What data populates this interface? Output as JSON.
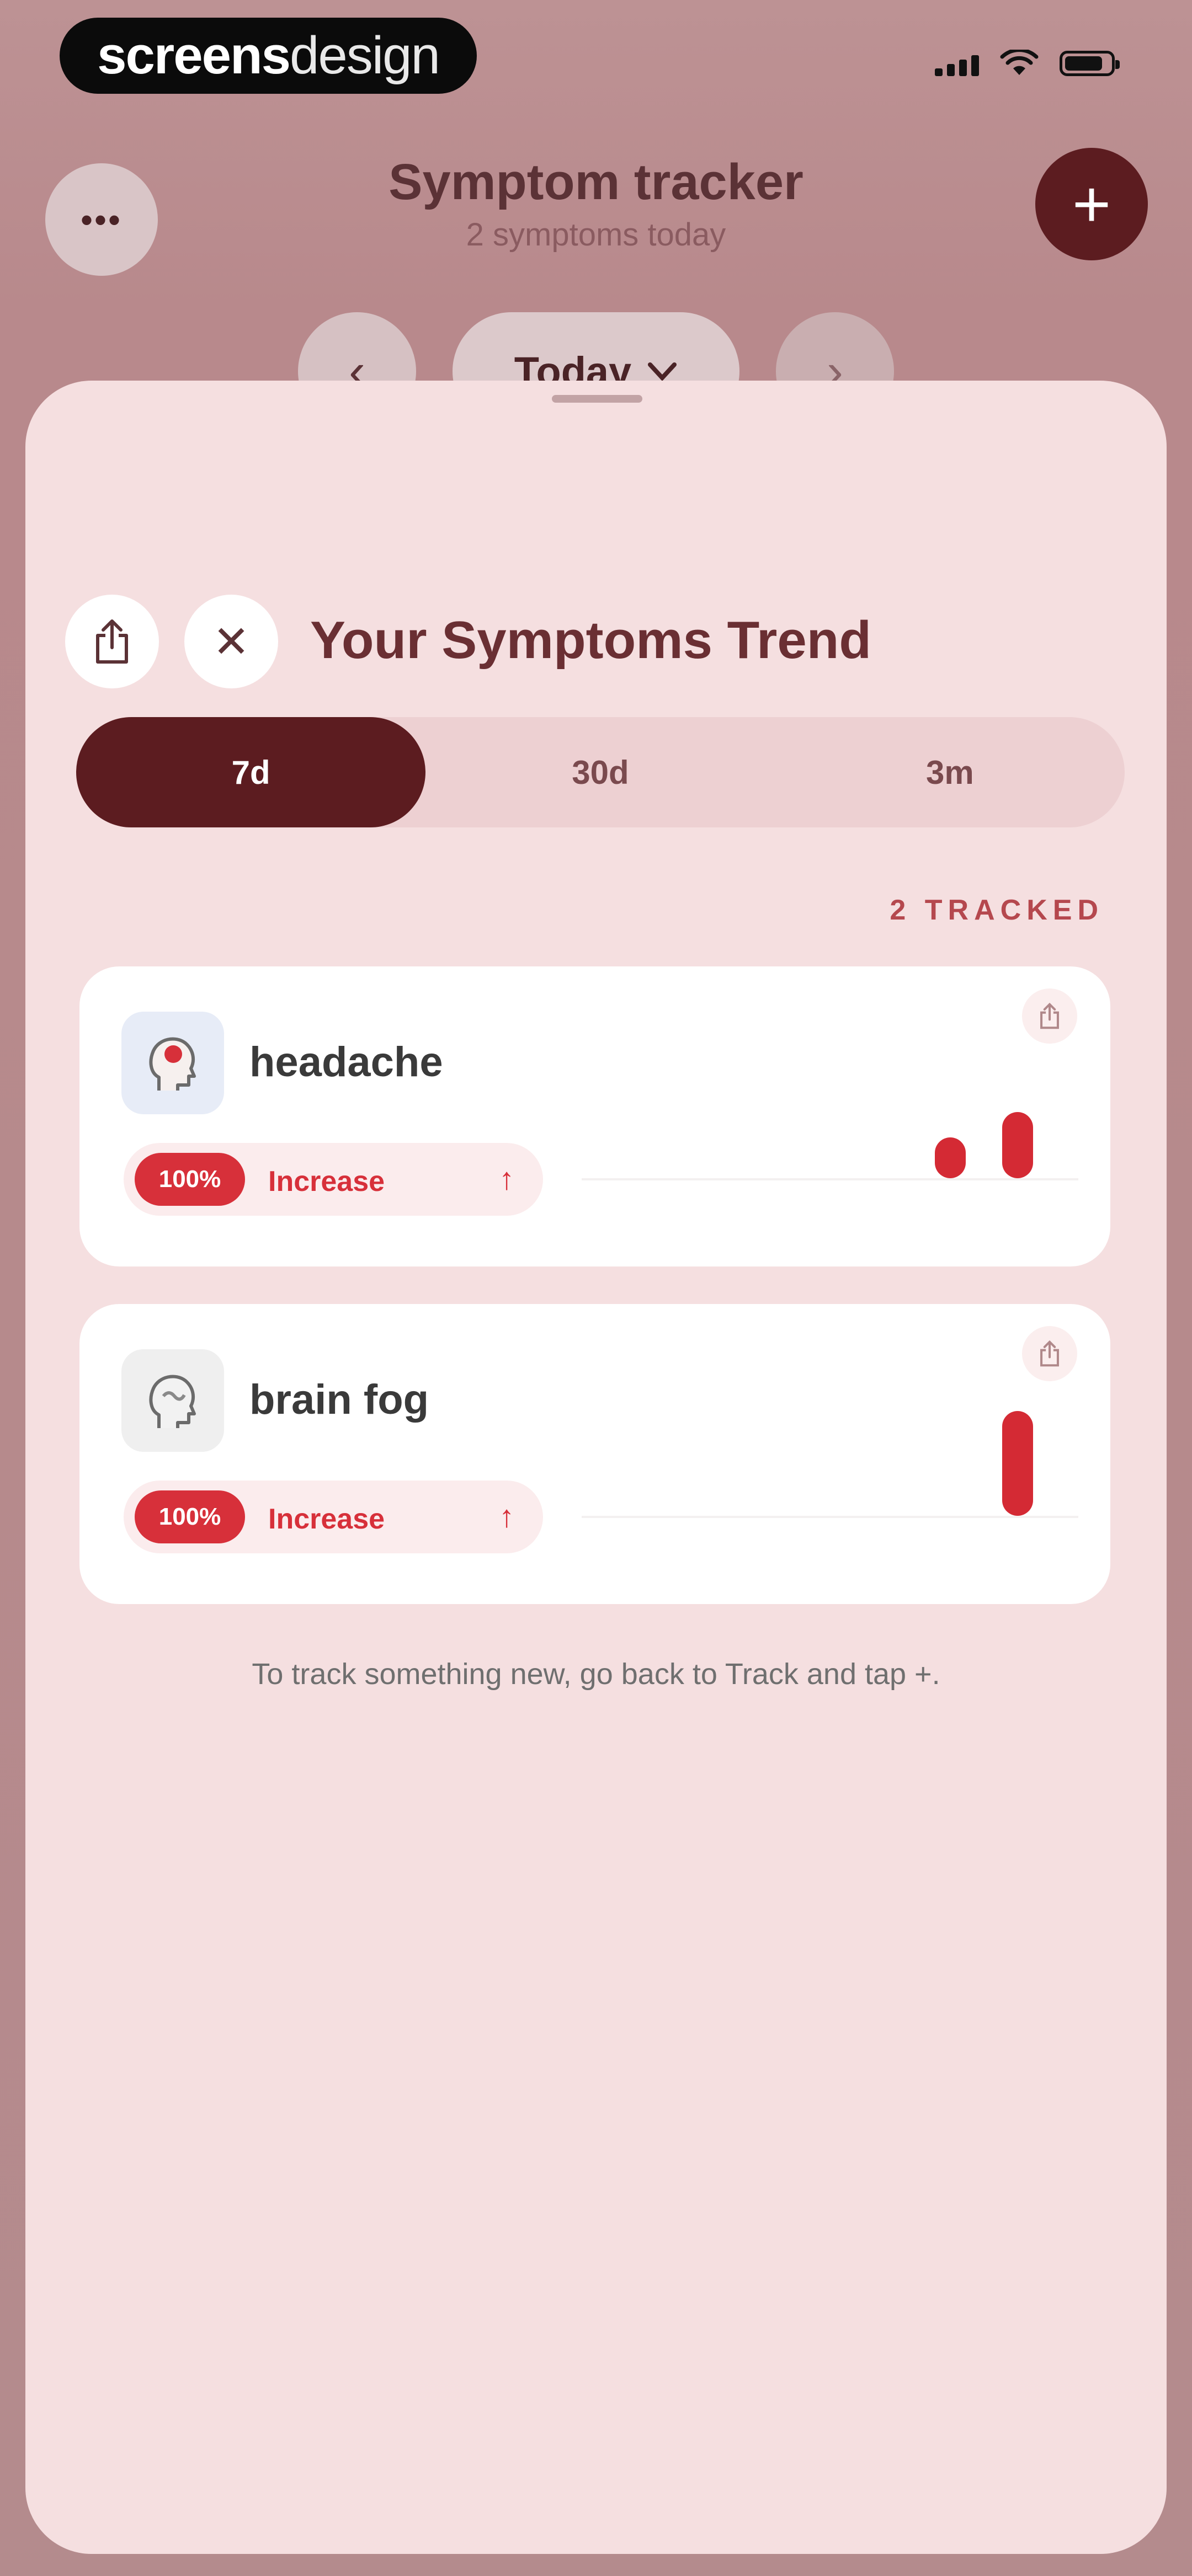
{
  "status_bar": {
    "brand_part1": "screens",
    "brand_part2": "design",
    "icons": [
      "cellular-signal-icon",
      "wifi-icon",
      "battery-icon"
    ]
  },
  "header": {
    "more_label": "•••",
    "title": "Symptom tracker",
    "subtitle": "2 symptoms today",
    "add_label": "+"
  },
  "date_nav": {
    "prev_label": "‹",
    "current_label": "Today",
    "next_label": "›"
  },
  "sheet": {
    "title": "Your Symptoms Trend",
    "close_label": "✕",
    "periods": [
      {
        "label": "7d",
        "selected": true
      },
      {
        "label": "30d",
        "selected": false
      },
      {
        "label": "3m",
        "selected": false
      }
    ],
    "tracked_label": "2 TRACKED",
    "symptoms": [
      {
        "name": "headache",
        "icon": "head-pain-icon",
        "change_percent": "100%",
        "change_label": "Increase",
        "change_arrow": "↑",
        "trend_values": [
          1,
          2
        ]
      },
      {
        "name": "brain fog",
        "icon": "brain-fog-icon",
        "change_percent": "100%",
        "change_label": "Increase",
        "change_arrow": "↑",
        "trend_values": [
          3
        ]
      }
    ],
    "footer_note": "To track something new, go back to Track and tap +."
  },
  "colors": {
    "accent_dark": "#5c1c20",
    "increase_red": "#d7303a",
    "sheet_bg": "#f5dfe0"
  }
}
